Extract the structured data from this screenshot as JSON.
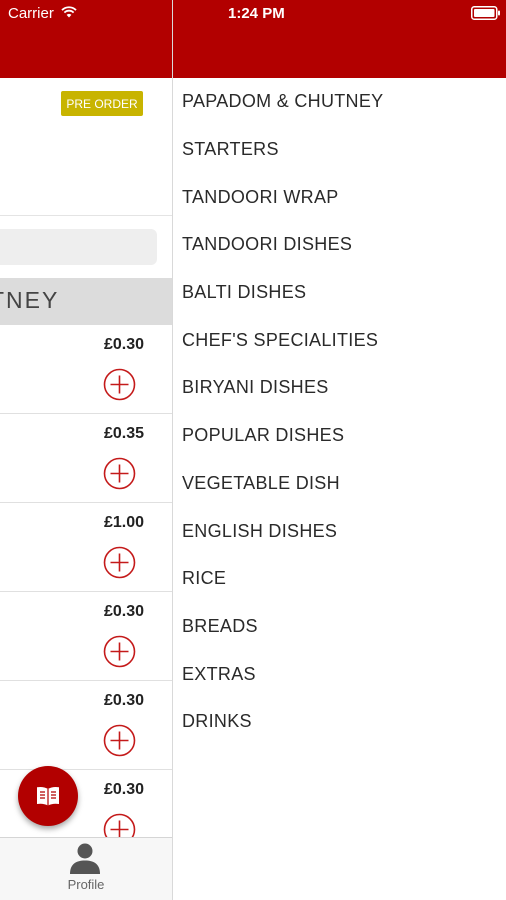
{
  "status_bar": {
    "carrier": "Carrier",
    "time": "1:24 PM"
  },
  "colors": {
    "brand_red": "#b20000",
    "preorder_badge": "#c8b400",
    "section_header_bg": "#dcdcdc"
  },
  "left_panel": {
    "preorder_label": "PRE ORDER",
    "section_title": "TNEY",
    "items": [
      {
        "price": "£0.30"
      },
      {
        "price": "£0.35"
      },
      {
        "price": "£1.00"
      },
      {
        "price": "£0.30"
      },
      {
        "price": "£0.30"
      },
      {
        "price": "£0.30"
      }
    ],
    "fab_icon": "menu-book-icon",
    "tab_bar": {
      "profile_label": "Profile",
      "profile_icon": "person-icon"
    }
  },
  "categories": [
    "PAPADOM & CHUTNEY",
    "STARTERS",
    "TANDOORI WRAP",
    "TANDOORI DISHES",
    "BALTI DISHES",
    "CHEF'S SPECIALITIES",
    "BIRYANI DISHES",
    "POPULAR DISHES",
    "VEGETABLE DISH",
    "ENGLISH DISHES",
    "RICE",
    "BREADS",
    "EXTRAS",
    "DRINKS"
  ]
}
